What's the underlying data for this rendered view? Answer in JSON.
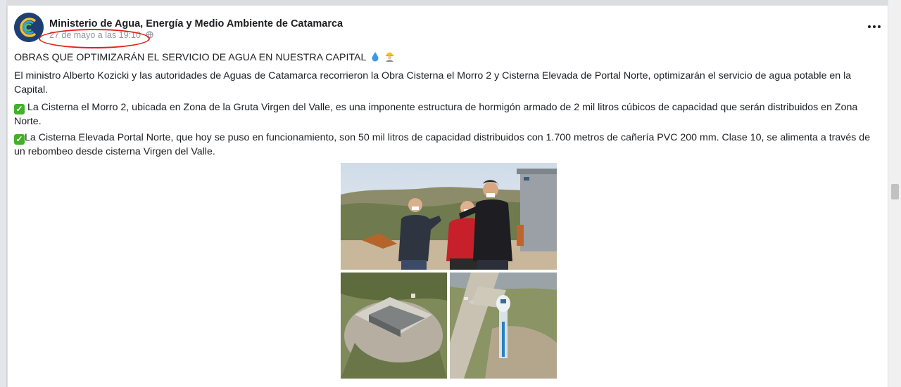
{
  "post": {
    "page_name": "Ministerio de Agua, Energía y Medio Ambiente de Catamarca",
    "timestamp": "27 de mayo a las 19:10",
    "headline": "OBRAS QUE OPTIMIZARÁN EL SERVICIO DE AGUA EN NUESTRA CAPITAL",
    "paragraph1": "El ministro Alberto Kozicki y las autoridades de Aguas de Catamarca recorrieron la Obra Cisterna el Morro 2 y Cisterna Elevada de Portal Norte, optimizarán el servicio de agua potable en la Capital.",
    "paragraph2": " La Cisterna el Morro 2, ubicada en Zona de la Gruta Virgen del Valle, es una imponente estructura de hormigón armado de 2 mil litros cúbicos de capacidad que serán distribuidos en Zona Norte.",
    "paragraph3": "La Cisterna Elevada Portal Norte, que hoy se puso en funcionamiento, son 50 mil litros de capacidad distribuidos con 1.700 metros de cañería PVC 200 mm. Clase 10, se alimenta a través de un rebombeo desde cisterna Virgen del Valle."
  },
  "icons": {
    "check": "check-mark-icon",
    "droplet": "droplet-icon",
    "worker": "construction-worker-icon",
    "globe": "globe-icon",
    "more": "more-options-icon"
  },
  "colors": {
    "annotation": "#e0201b",
    "check": "#43b02a",
    "avatar": "#1f3f73"
  }
}
